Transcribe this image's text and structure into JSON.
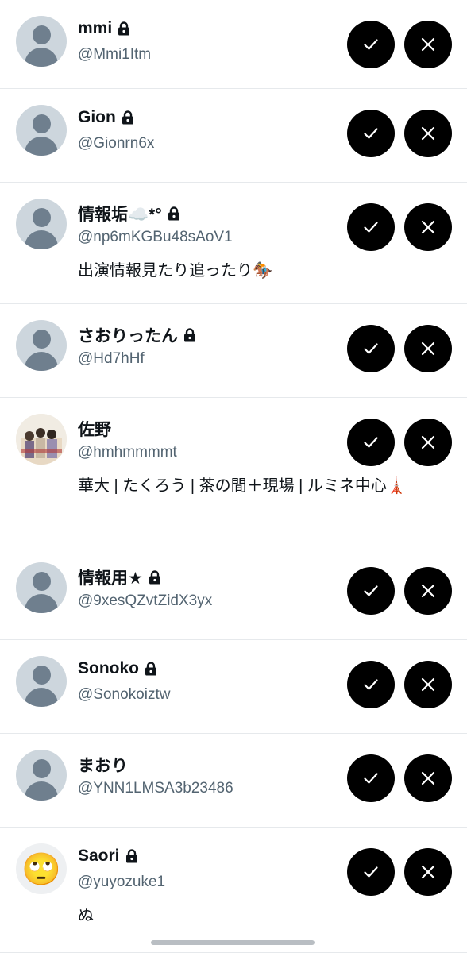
{
  "requests": [
    {
      "name": "mmi",
      "handle": "@Mmi1Itm",
      "protected": true,
      "bio": "",
      "avatar": "default"
    },
    {
      "name": "Gion",
      "handle": "@Gionrn6x",
      "protected": true,
      "bio": "",
      "avatar": "default"
    },
    {
      "name": "情報垢☁️*°",
      "handle": "@np6mKGBu48sAoV1",
      "protected": true,
      "bio": "出演情報見たり追ったり🏇",
      "avatar": "default"
    },
    {
      "name": "さおりったん",
      "handle": "@Hd7hHf",
      "protected": true,
      "bio": "",
      "avatar": "default"
    },
    {
      "name": "佐野",
      "handle": "@hmhmmmmt",
      "protected": false,
      "bio": "華大 | たくろう | 茶の間＋現場 | ルミネ中心🗼",
      "avatar": "photo"
    },
    {
      "name": "情報用★",
      "handle": "@9xesQZvtZidX3yx",
      "protected": true,
      "bio": "",
      "avatar": "default"
    },
    {
      "name": "Sonoko",
      "handle": "@Sonokoiztw",
      "protected": true,
      "bio": "",
      "avatar": "default"
    },
    {
      "name": "まおり",
      "handle": "@YNN1LMSA3b23486",
      "protected": false,
      "bio": "",
      "avatar": "default"
    },
    {
      "name": "Saori",
      "handle": "@yuyozuke1",
      "protected": true,
      "bio": "ぬ",
      "avatar": "emoji",
      "avatar_emoji": "🙄"
    }
  ],
  "icons": {
    "accept": "checkmark-icon",
    "decline": "close-icon",
    "lock": "lock-icon"
  },
  "colors": {
    "button": "#000000",
    "handle": "#536471",
    "divider": "#e6e9ec"
  }
}
